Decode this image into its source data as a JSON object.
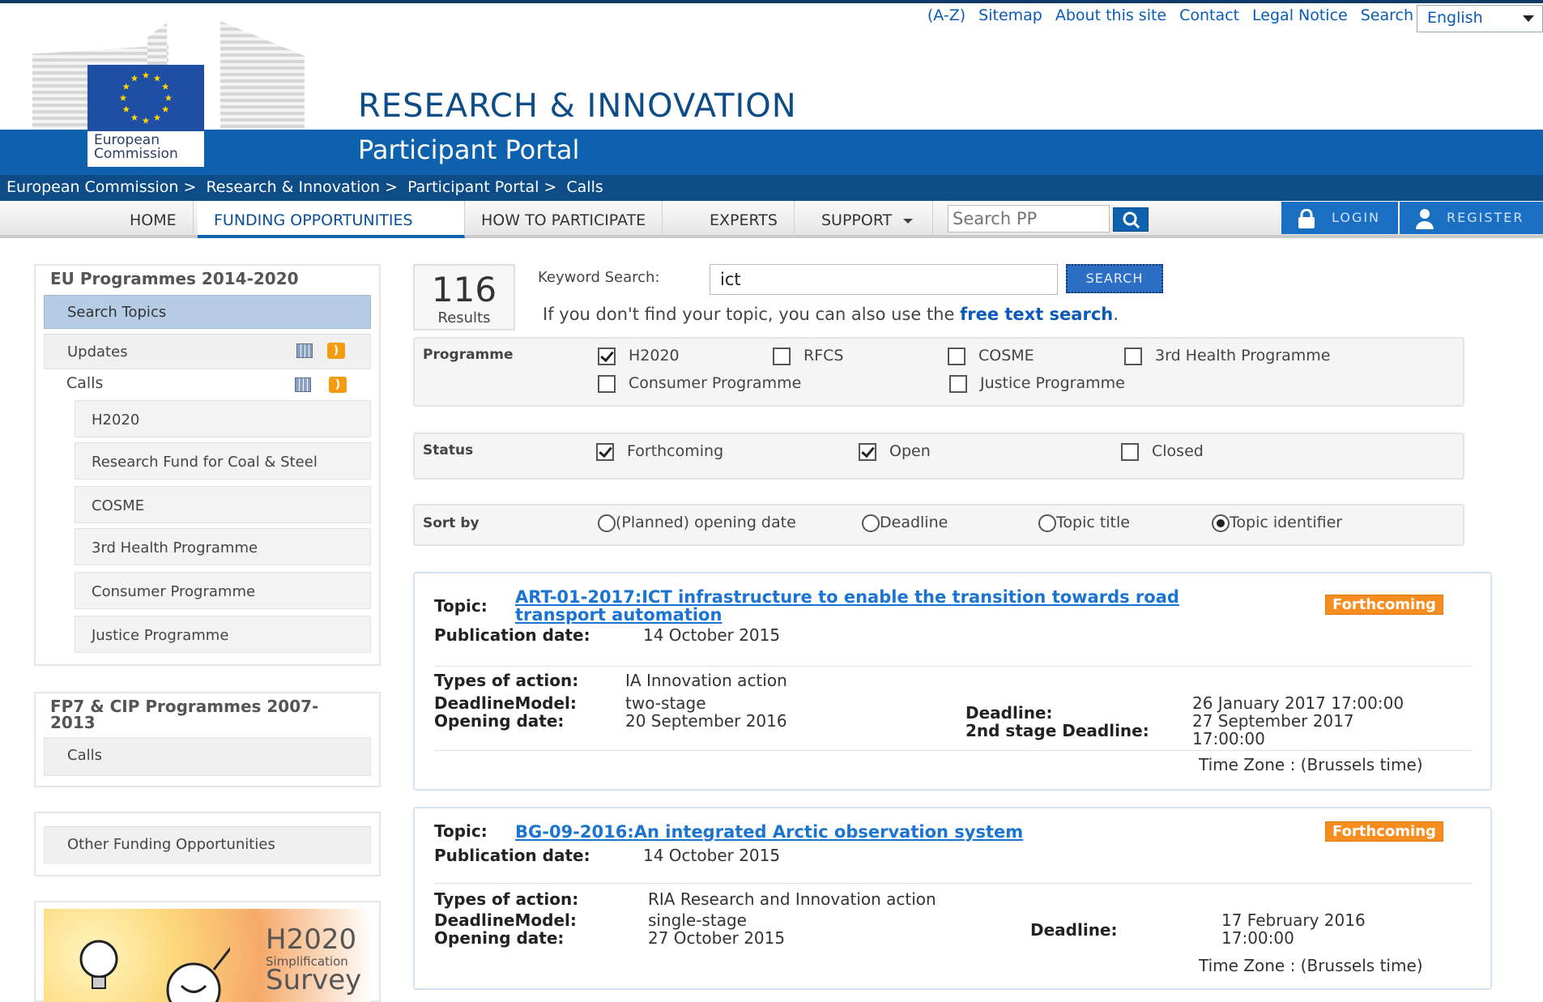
{
  "top_links": [
    "(A-Z)",
    "Sitemap",
    "About this site",
    "Contact",
    "Legal Notice",
    "Search"
  ],
  "language": "English",
  "logo": {
    "line1": "European",
    "line2": "Commission"
  },
  "site_title": "RESEARCH & INNOVATION",
  "site_subtitle": "Participant Portal",
  "breadcrumb": [
    "European Commission",
    "Research & Innovation",
    "Participant Portal",
    "Calls"
  ],
  "nav": {
    "items": [
      "HOME",
      "FUNDING OPPORTUNITIES",
      "HOW TO PARTICIPATE",
      "EXPERTS",
      "SUPPORT"
    ],
    "search_placeholder": "Search PP",
    "login": "LOGIN",
    "register": "REGISTER"
  },
  "sidebar": {
    "eu_heading": "EU Programmes 2014-2020",
    "search_topics": "Search Topics",
    "updates": "Updates",
    "calls": "Calls",
    "call_programmes": [
      "H2020",
      "Research Fund for Coal & Steel",
      "COSME",
      "3rd Health Programme",
      "Consumer Programme",
      "Justice Programme"
    ],
    "fp7_heading": "FP7 & CIP Programmes 2007-2013",
    "fp7_calls": "Calls",
    "other_funding": "Other Funding Opportunities",
    "survey": {
      "title": "H2020",
      "sub": "Simplification",
      "word": "Survey"
    }
  },
  "results": {
    "count": "116",
    "label": "Results"
  },
  "keyword": {
    "label": "Keyword Search:",
    "value": "ict",
    "button": "SEARCH"
  },
  "hint": {
    "text": "If you don't find your topic, you can also use the ",
    "link": "free text search",
    "end": "."
  },
  "programme_filter": {
    "label": "Programme",
    "options": [
      {
        "name": "H2020",
        "checked": true
      },
      {
        "name": "RFCS",
        "checked": false
      },
      {
        "name": "COSME",
        "checked": false
      },
      {
        "name": "3rd Health Programme",
        "checked": false
      },
      {
        "name": "Consumer Programme",
        "checked": false
      },
      {
        "name": "Justice Programme",
        "checked": false
      }
    ]
  },
  "status_filter": {
    "label": "Status",
    "options": [
      {
        "name": "Forthcoming",
        "checked": true
      },
      {
        "name": "Open",
        "checked": true
      },
      {
        "name": "Closed",
        "checked": false
      }
    ]
  },
  "sort": {
    "label": "Sort by",
    "options": [
      {
        "name": "(Planned) opening date",
        "selected": false
      },
      {
        "name": "Deadline",
        "selected": false
      },
      {
        "name": "Topic title",
        "selected": false
      },
      {
        "name": "Topic identifier",
        "selected": true
      }
    ]
  },
  "labels": {
    "topic": "Topic:",
    "publication": "Publication date:",
    "types": "Types of action:",
    "model": "DeadlineModel:",
    "opening": "Opening date:",
    "deadline": "Deadline:",
    "deadline2": "2nd stage Deadline:",
    "timezone": "Time Zone : (Brussels time)"
  },
  "topics": [
    {
      "title_line1": "ART-01-2017:ICT infrastructure to enable the transition towards road",
      "title_line2": "transport automation",
      "status": "Forthcoming",
      "publication_date": "14 October 2015",
      "type_of_action": "IA Innovation action",
      "deadline_model": "two-stage",
      "opening_date": "20 September 2016",
      "deadline": "26 January 2017 17:00:00",
      "deadline2_a": "27 September 2017",
      "deadline2_b": "17:00:00"
    },
    {
      "title_line1": "BG-09-2016:An integrated Arctic observation system",
      "status": "Forthcoming",
      "publication_date": "14 October 2015",
      "type_of_action": "RIA Research and Innovation action",
      "deadline_model": "single-stage",
      "opening_date": "27 October 2015",
      "deadline_a": "17 February 2016",
      "deadline_b": "17:00:00"
    }
  ],
  "colors": {
    "brand_blue": "#0e62ad",
    "dark_blue": "#0d4c86",
    "badge_orange": "#f78d1e",
    "link_blue": "#1c74d2"
  }
}
